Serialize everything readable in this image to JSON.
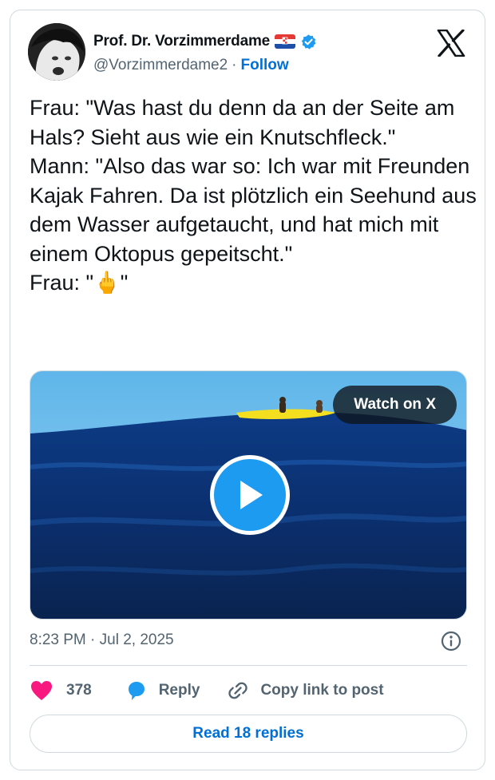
{
  "author": {
    "display_name": "Prof. Dr. Vorzimmerdame",
    "handle": "@Vorzimmerdame2",
    "separator": "·",
    "follow_label": "Follow",
    "flag_icon": "croatia-flag-icon",
    "verified_icon": "verified-badge-icon"
  },
  "tweet": {
    "text": "Frau: \"Was hast du denn da an der Seite am Hals? Sieht aus wie ein Knutschfleck.\"\nMann: \"Also das war so: Ich war mit Freunden Kajak Fahren. Da ist plötzlich ein Seehund aus dem Wasser aufgetaucht, und hat mich mit einem Oktopus gepeitscht.\"\nFrau: \"🖕\""
  },
  "media": {
    "watch_label": "Watch on X",
    "play_icon": "play-icon"
  },
  "timestamp": "8:23 PM · Jul 2, 2025",
  "actions": {
    "like_count": "378",
    "reply_label": "Reply",
    "copy_label": "Copy link to post"
  },
  "read_replies_label": "Read 18 replies",
  "colors": {
    "accent": "#1d9bf0",
    "link": "#006fd6",
    "like": "#f91880",
    "muted": "#536471",
    "border": "#cfd9de"
  }
}
